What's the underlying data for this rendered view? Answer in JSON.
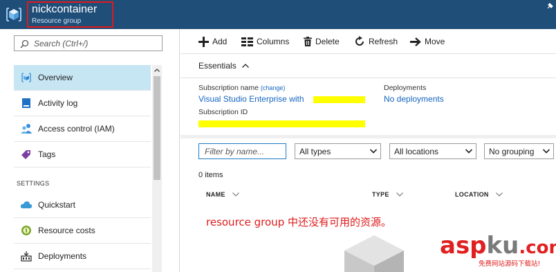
{
  "header": {
    "title": "nickcontainer",
    "subtitle": "Resource group",
    "logo_icon": "resource-group-cube-icon",
    "pin_icon": "pin-icon",
    "background_color": "#1f4e79",
    "highlight_border_color": "#e01a1a"
  },
  "search": {
    "placeholder": "Search (Ctrl+/)",
    "icon": "search-icon"
  },
  "nav": {
    "items": [
      {
        "label": "Overview",
        "icon": "overview-cube-icon",
        "active": true
      },
      {
        "label": "Activity log",
        "icon": "activity-log-icon"
      },
      {
        "label": "Access control (IAM)",
        "icon": "users-icon"
      },
      {
        "label": "Tags",
        "icon": "tag-icon"
      }
    ],
    "settings_label": "SETTINGS",
    "settings_items": [
      {
        "label": "Quickstart",
        "icon": "cloud-icon"
      },
      {
        "label": "Resource costs",
        "icon": "cost-icon"
      },
      {
        "label": "Deployments",
        "icon": "deployments-icon"
      }
    ],
    "active_color": "#c6e6f4"
  },
  "toolbar": {
    "add": "Add",
    "columns": "Columns",
    "delete": "Delete",
    "refresh": "Refresh",
    "move": "Move"
  },
  "essentials": {
    "label": "Essentials",
    "subscription_name_label": "Subscription name",
    "change_link": "(change)",
    "subscription_name_value": "Visual Studio Enterprise with",
    "subscription_id_label": "Subscription ID",
    "deployments_label": "Deployments",
    "deployments_value": "No deployments",
    "highlight_color": "#ffff00",
    "link_color": "#1565c0"
  },
  "filters": {
    "name_placeholder": "Filter by name...",
    "types": "All types",
    "locations": "All locations",
    "grouping": "No grouping"
  },
  "list": {
    "count": "0 items",
    "columns": [
      "NAME",
      "TYPE",
      "LOCATION"
    ],
    "empty_message": "resource group 中还没有可用的资源。",
    "empty_message_color": "#e01a1a"
  },
  "watermark": {
    "part1": "asp",
    "part2": "ku",
    "part3": ".com",
    "tagline": "免费网站源码下载站!"
  }
}
